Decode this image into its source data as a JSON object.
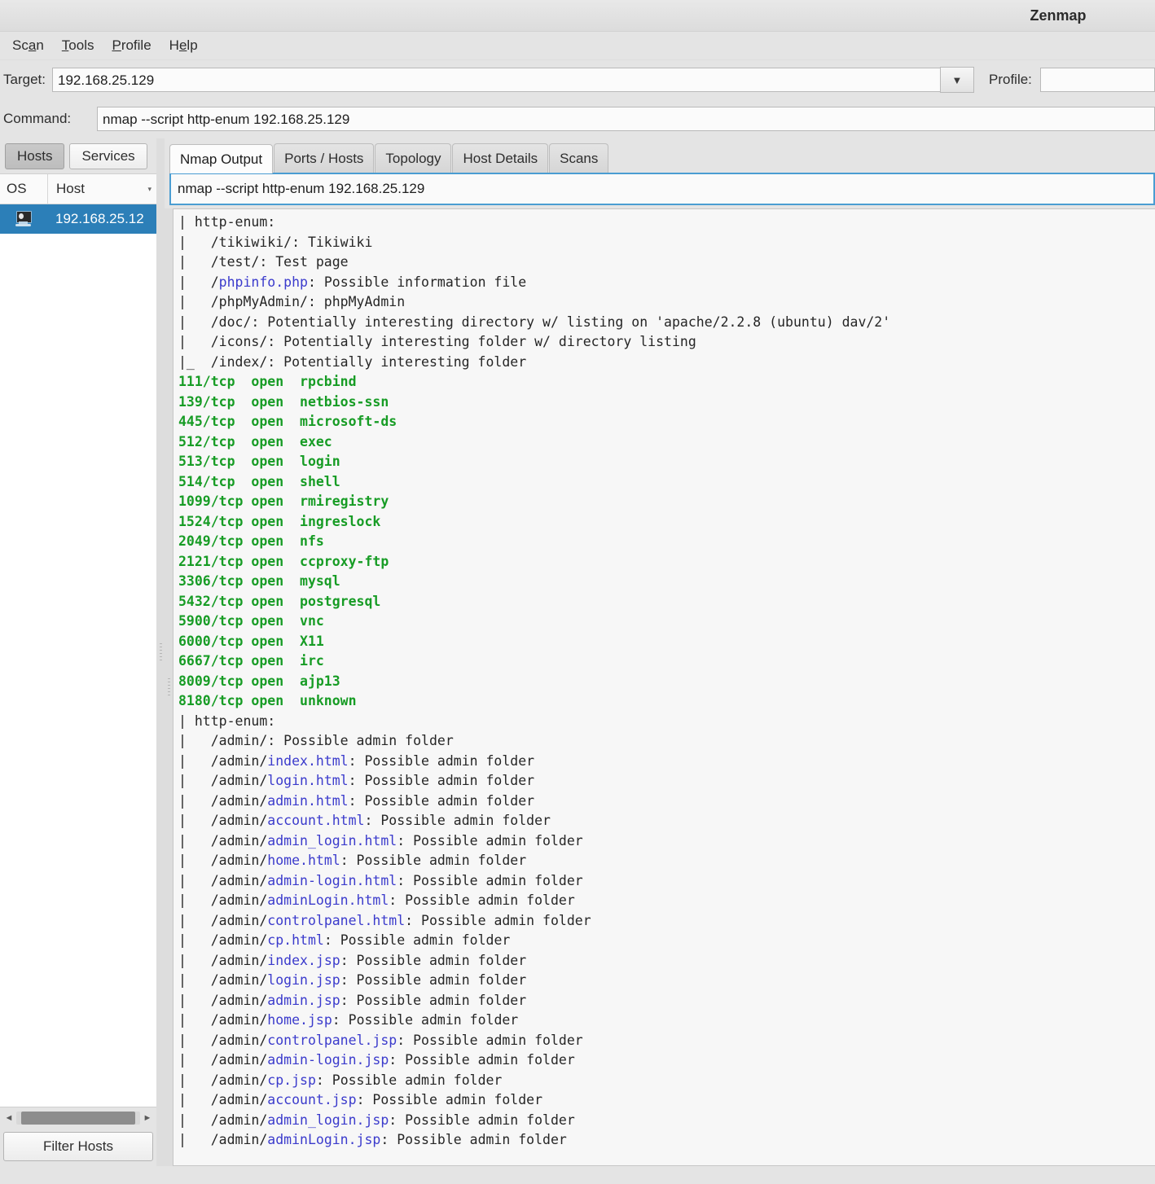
{
  "window": {
    "title": "Zenmap"
  },
  "menu": {
    "items": [
      {
        "pre": "Sc",
        "key": "a",
        "post": "n"
      },
      {
        "pre": "",
        "key": "T",
        "post": "ools"
      },
      {
        "pre": "",
        "key": "P",
        "post": "rofile"
      },
      {
        "pre": "H",
        "key": "e",
        "post": "lp"
      }
    ]
  },
  "toolbar": {
    "target_label": "Target:",
    "target_value": "192.168.25.129",
    "target_placeholder": "",
    "profile_label": "Profile:",
    "profile_value": "",
    "profile_placeholder": "",
    "command_label": "Command:",
    "command_value": "nmap --script http-enum 192.168.25.129",
    "command_placeholder": "",
    "dropdown_glyph": "▼"
  },
  "sidebar": {
    "buttons": [
      {
        "label": "Hosts",
        "active": true
      },
      {
        "label": "Services",
        "active": false
      }
    ],
    "columns": {
      "os": "OS",
      "host": "Host",
      "sort_glyph": "▾"
    },
    "rows": [
      {
        "os_icon": "computer-icon",
        "host": "192.168.25.12"
      }
    ],
    "filter_button": "Filter Hosts",
    "scroll_left_glyph": "◄",
    "scroll_right_glyph": "►"
  },
  "tabs": [
    {
      "label": "Nmap Output",
      "active": true
    },
    {
      "label": "Ports / Hosts",
      "active": false
    },
    {
      "label": "Topology",
      "active": false
    },
    {
      "label": "Host Details",
      "active": false
    },
    {
      "label": "Scans",
      "active": false
    }
  ],
  "command_display": "nmap --script http-enum 192.168.25.129",
  "output_lines": [
    [
      {
        "t": "| http-enum: "
      }
    ],
    [
      {
        "t": "|   /tikiwiki/: Tikiwiki"
      }
    ],
    [
      {
        "t": "|   /test/: Test page"
      }
    ],
    [
      {
        "t": "|   /"
      },
      {
        "t": "phpinfo.php",
        "c": "hl"
      },
      {
        "t": ": Possible information file"
      }
    ],
    [
      {
        "t": "|   /phpMyAdmin/: phpMyAdmin"
      }
    ],
    [
      {
        "t": "|   /doc/: Potentially interesting directory w/ listing on 'apache/2.2.8 (ubuntu) dav/2'"
      }
    ],
    [
      {
        "t": "|   /icons/: Potentially interesting folder w/ directory listing"
      }
    ],
    [
      {
        "t": "|_  /index/: Potentially interesting folder"
      }
    ],
    [
      {
        "t": "111/tcp  open  rpcbind",
        "c": "port"
      }
    ],
    [
      {
        "t": "139/tcp  open  netbios-ssn",
        "c": "port"
      }
    ],
    [
      {
        "t": "445/tcp  open  microsoft-ds",
        "c": "port"
      }
    ],
    [
      {
        "t": "512/tcp  open  exec",
        "c": "port"
      }
    ],
    [
      {
        "t": "513/tcp  open  login",
        "c": "port"
      }
    ],
    [
      {
        "t": "514/tcp  open  shell",
        "c": "port"
      }
    ],
    [
      {
        "t": "1099/tcp open  rmiregistry",
        "c": "port"
      }
    ],
    [
      {
        "t": "1524/tcp open  ingreslock",
        "c": "port"
      }
    ],
    [
      {
        "t": "2049/tcp open  nfs",
        "c": "port"
      }
    ],
    [
      {
        "t": "2121/tcp open  ccproxy-ftp",
        "c": "port"
      }
    ],
    [
      {
        "t": "3306/tcp open  mysql",
        "c": "port"
      }
    ],
    [
      {
        "t": "5432/tcp open  postgresql",
        "c": "port"
      }
    ],
    [
      {
        "t": "5900/tcp open  vnc",
        "c": "port"
      }
    ],
    [
      {
        "t": "6000/tcp open  X11",
        "c": "port"
      }
    ],
    [
      {
        "t": "6667/tcp open  irc",
        "c": "port"
      }
    ],
    [
      {
        "t": "8009/tcp open  ajp13",
        "c": "port"
      }
    ],
    [
      {
        "t": "8180/tcp open  unknown",
        "c": "port"
      }
    ],
    [
      {
        "t": "| http-enum: "
      }
    ],
    [
      {
        "t": "|   /admin/: Possible admin folder"
      }
    ],
    [
      {
        "t": "|   /admin/"
      },
      {
        "t": "index.html",
        "c": "hl"
      },
      {
        "t": ": Possible admin folder"
      }
    ],
    [
      {
        "t": "|   /admin/"
      },
      {
        "t": "login.html",
        "c": "hl"
      },
      {
        "t": ": Possible admin folder"
      }
    ],
    [
      {
        "t": "|   /admin/"
      },
      {
        "t": "admin.html",
        "c": "hl"
      },
      {
        "t": ": Possible admin folder"
      }
    ],
    [
      {
        "t": "|   /admin/"
      },
      {
        "t": "account.html",
        "c": "hl"
      },
      {
        "t": ": Possible admin folder"
      }
    ],
    [
      {
        "t": "|   /admin/"
      },
      {
        "t": "admin_login.html",
        "c": "hl"
      },
      {
        "t": ": Possible admin folder"
      }
    ],
    [
      {
        "t": "|   /admin/"
      },
      {
        "t": "home.html",
        "c": "hl"
      },
      {
        "t": ": Possible admin folder"
      }
    ],
    [
      {
        "t": "|   /admin/"
      },
      {
        "t": "admin-login.html",
        "c": "hl"
      },
      {
        "t": ": Possible admin folder"
      }
    ],
    [
      {
        "t": "|   /admin/"
      },
      {
        "t": "adminLogin.html",
        "c": "hl"
      },
      {
        "t": ": Possible admin folder"
      }
    ],
    [
      {
        "t": "|   /admin/"
      },
      {
        "t": "controlpanel.html",
        "c": "hl"
      },
      {
        "t": ": Possible admin folder"
      }
    ],
    [
      {
        "t": "|   /admin/"
      },
      {
        "t": "cp.html",
        "c": "hl"
      },
      {
        "t": ": Possible admin folder"
      }
    ],
    [
      {
        "t": "|   /admin/"
      },
      {
        "t": "index.jsp",
        "c": "hl"
      },
      {
        "t": ": Possible admin folder"
      }
    ],
    [
      {
        "t": "|   /admin/"
      },
      {
        "t": "login.jsp",
        "c": "hl"
      },
      {
        "t": ": Possible admin folder"
      }
    ],
    [
      {
        "t": "|   /admin/"
      },
      {
        "t": "admin.jsp",
        "c": "hl"
      },
      {
        "t": ": Possible admin folder"
      }
    ],
    [
      {
        "t": "|   /admin/"
      },
      {
        "t": "home.jsp",
        "c": "hl"
      },
      {
        "t": ": Possible admin folder"
      }
    ],
    [
      {
        "t": "|   /admin/"
      },
      {
        "t": "controlpanel.jsp",
        "c": "hl"
      },
      {
        "t": ": Possible admin folder"
      }
    ],
    [
      {
        "t": "|   /admin/"
      },
      {
        "t": "admin-login.jsp",
        "c": "hl"
      },
      {
        "t": ": Possible admin folder"
      }
    ],
    [
      {
        "t": "|   /admin/"
      },
      {
        "t": "cp.jsp",
        "c": "hl"
      },
      {
        "t": ": Possible admin folder"
      }
    ],
    [
      {
        "t": "|   /admin/"
      },
      {
        "t": "account.jsp",
        "c": "hl"
      },
      {
        "t": ": Possible admin folder"
      }
    ],
    [
      {
        "t": "|   /admin/"
      },
      {
        "t": "admin_login.jsp",
        "c": "hl"
      },
      {
        "t": ": Possible admin folder"
      }
    ],
    [
      {
        "t": "|   /admin/"
      },
      {
        "t": "adminLogin.jsp",
        "c": "hl"
      },
      {
        "t": ": Possible admin folder"
      }
    ]
  ],
  "colors": {
    "selection_blue": "#2c7fb8",
    "port_green": "#179c25",
    "highlight_blue": "#3b3bcc",
    "focus_border": "#4a9dd2"
  }
}
